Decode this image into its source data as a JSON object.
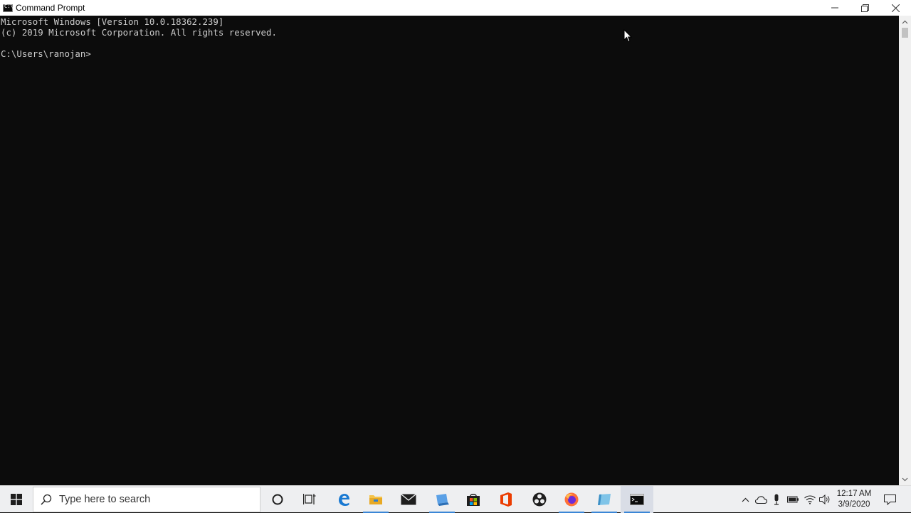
{
  "window": {
    "title": "Command Prompt",
    "icon": "cmd-icon",
    "controls": [
      "minimize-icon",
      "restore-icon",
      "close-icon"
    ]
  },
  "console": {
    "lines": [
      "Microsoft Windows [Version 10.0.18362.239]",
      "(c) 2019 Microsoft Corporation. All rights reserved.",
      "",
      "C:\\Users\\ranojan>"
    ],
    "background": "#0c0c0c",
    "foreground": "#cccccc"
  },
  "taskbar": {
    "search_placeholder": "Type here to search",
    "pinned": [
      {
        "name": "cortana-icon"
      },
      {
        "name": "task-view-icon"
      },
      {
        "name": "edge-icon"
      },
      {
        "name": "file-explorer-icon"
      },
      {
        "name": "mail-icon"
      },
      {
        "name": "virtual-machine-icon"
      },
      {
        "name": "store-icon"
      },
      {
        "name": "office-icon"
      },
      {
        "name": "obs-icon"
      },
      {
        "name": "firefox-icon"
      },
      {
        "name": "notepad-icon"
      },
      {
        "name": "command-prompt-icon"
      }
    ],
    "tray_icons": [
      "show-hidden-icons",
      "onedrive-icon",
      "microphone-icon",
      "battery-icon",
      "wifi-icon",
      "volume-icon"
    ],
    "clock": {
      "time": "12:17 AM",
      "date": "3/9/2020"
    },
    "accent": "#3a86d6"
  }
}
